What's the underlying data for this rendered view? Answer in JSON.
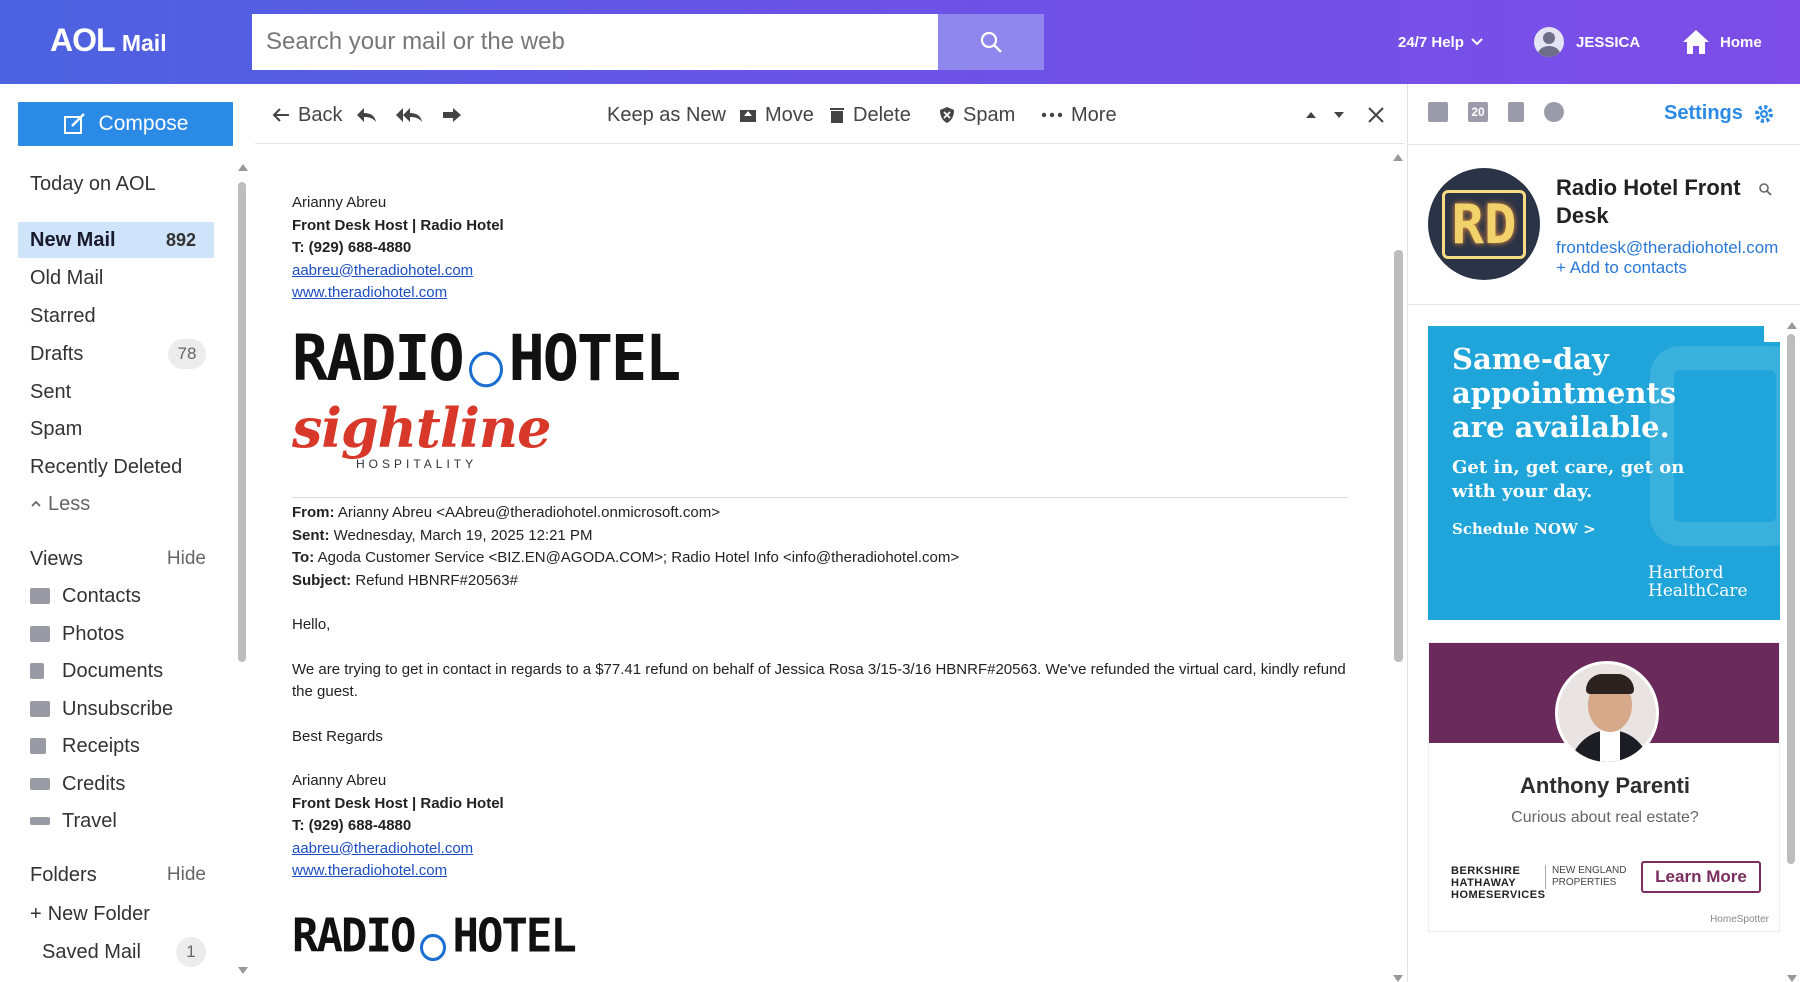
{
  "header": {
    "logo_aol": "AOL",
    "logo_mail": "Mail",
    "search_placeholder": "Search your mail or the web",
    "help_label": "24/7 Help",
    "user_label": "JESSICA",
    "home_label": "Home"
  },
  "sidebar": {
    "compose_label": "Compose",
    "today": "Today on AOL",
    "folders": [
      {
        "label": "New Mail",
        "count": "892"
      },
      {
        "label": "Old Mail"
      },
      {
        "label": "Starred"
      },
      {
        "label": "Drafts",
        "count": "78"
      },
      {
        "label": "Sent"
      },
      {
        "label": "Spam"
      },
      {
        "label": "Recently Deleted"
      }
    ],
    "less_label": "Less",
    "views_label": "Views",
    "views_hide": "Hide",
    "views": [
      "Contacts",
      "Photos",
      "Documents",
      "Unsubscribe",
      "Receipts",
      "Credits",
      "Travel"
    ],
    "folders_label": "Folders",
    "folders_hide": "Hide",
    "new_folder": "New Folder",
    "saved_mail": "Saved Mail",
    "saved_mail_count": "1"
  },
  "toolbar": {
    "back": "Back",
    "keep_as_new": "Keep as New",
    "move": "Move",
    "delete": "Delete",
    "spam": "Spam",
    "more": "More"
  },
  "message": {
    "sig": {
      "name": "Arianny Abreu",
      "title": "Front Desk Host | Radio Hotel",
      "phone": "T: (929) 688-4880",
      "email": "aabreu@theradiohotel.com",
      "web": "www.theradiohotel.com"
    },
    "logo_radio_left": "RADIO",
    "logo_radio_right": "HOTEL",
    "logo_sightline": "sightline",
    "logo_hospitality": "HOSPITALITY",
    "from_label": "From:",
    "from_value": "Arianny Abreu <AAbreu@theradiohotel.onmicrosoft.com>",
    "sent_label": "Sent:",
    "sent_value": "Wednesday, March 19, 2025 12:21 PM",
    "to_label": "To:",
    "to_value": "Agoda Customer Service <BIZ.EN@AGODA.COM>; Radio Hotel Info <info@theradiohotel.com>",
    "subject_label": "Subject:",
    "subject_value": "Refund HBNRF#20563#",
    "greeting": "Hello,",
    "body": "We are trying to get in contact in regards to a $77.41 refund on behalf of Jessica Rosa 3/15-3/16 HBNRF#20563. We've refunded the virtual card, kindly refund the guest.",
    "closing": "Best Regards"
  },
  "right_panel": {
    "settings_label": "Settings",
    "calendar_day": "20",
    "contact_initials": "RD",
    "contact_name": "Radio Hotel Front Desk",
    "contact_email": "frontdesk@theradiohotel.com",
    "add_contacts": "+ Add to contacts",
    "ad1": {
      "headline": "Same-day appointments are available.",
      "sub": "Get in, get care, get on with your day.",
      "cta": "Schedule NOW >",
      "brand": "Hartford HealthCare"
    },
    "ad2": {
      "name": "Anthony Parenti",
      "sub": "Curious about real estate?",
      "brand": "BERKSHIRE HATHAWAY HOMESERVICES",
      "brand2": "NEW ENGLAND PROPERTIES",
      "cta": "Learn More",
      "footer": "HomeSpotter"
    }
  },
  "colors": {
    "header_gradient_start": "#4b63e0",
    "header_gradient_end": "#7d4ee8",
    "accent": "#2a8ae6",
    "active_bg": "#cfe4fa",
    "link": "#1d4fc4"
  }
}
